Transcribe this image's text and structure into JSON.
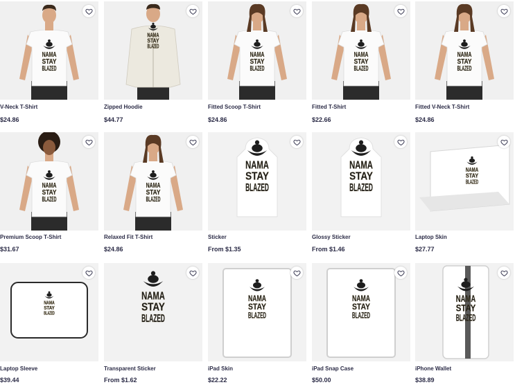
{
  "design": {
    "line1": "NAMA",
    "line2": "STAY",
    "line3": "BLAZED"
  },
  "products": [
    {
      "name": "V-Neck T-Shirt",
      "price": "$24.86",
      "kind": "tee-man"
    },
    {
      "name": "Zipped Hoodie",
      "price": "$44.77",
      "kind": "hoodie"
    },
    {
      "name": "Fitted Scoop T-Shirt",
      "price": "$24.86",
      "kind": "tee-woman"
    },
    {
      "name": "Fitted T-Shirt",
      "price": "$22.66",
      "kind": "tee-woman"
    },
    {
      "name": "Fitted V-Neck T-Shirt",
      "price": "$24.86",
      "kind": "tee-woman"
    },
    {
      "name": "Premium Scoop T-Shirt",
      "price": "$31.67",
      "kind": "tee-woman-curly"
    },
    {
      "name": "Relaxed Fit T-Shirt",
      "price": "$24.86",
      "kind": "tee-woman"
    },
    {
      "name": "Sticker",
      "price": "From $1.35",
      "kind": "sticker"
    },
    {
      "name": "Glossy Sticker",
      "price": "From $1.46",
      "kind": "sticker"
    },
    {
      "name": "Laptop Skin",
      "price": "$27.77",
      "kind": "laptop"
    },
    {
      "name": "Laptop Sleeve",
      "price": "$39.44",
      "kind": "sleeve"
    },
    {
      "name": "Transparent Sticker",
      "price": "From $1.62",
      "kind": "sticker-plain"
    },
    {
      "name": "iPad Skin",
      "price": "$22.22",
      "kind": "ipad"
    },
    {
      "name": "iPad Snap Case",
      "price": "$50.00",
      "kind": "ipad"
    },
    {
      "name": "iPhone Wallet",
      "price": "$38.89",
      "kind": "wallet"
    }
  ]
}
